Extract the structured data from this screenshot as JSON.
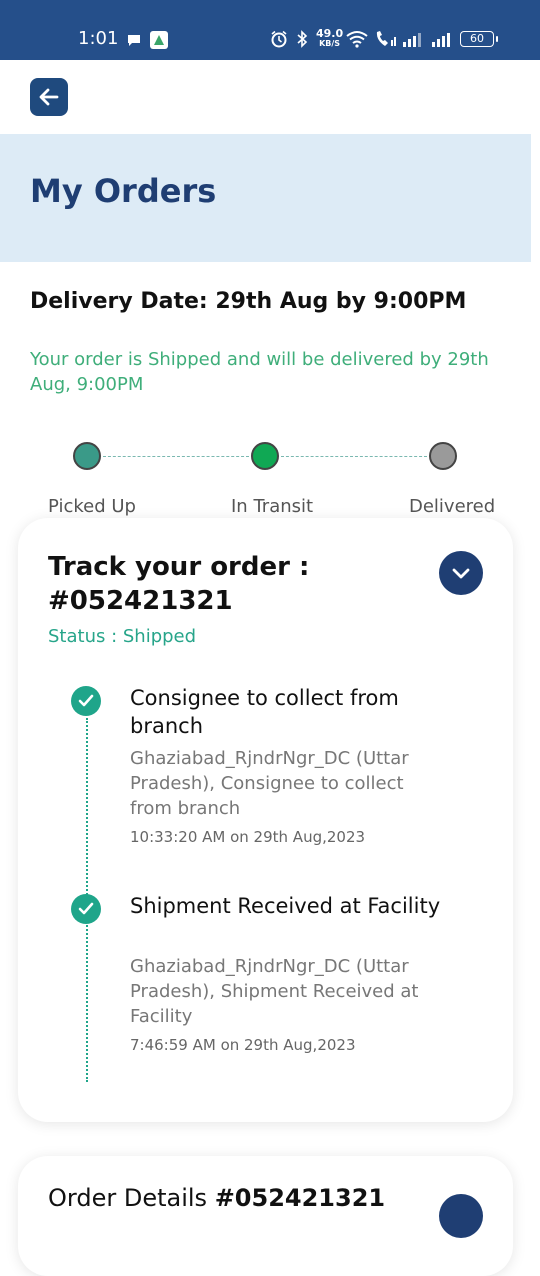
{
  "status_bar": {
    "time": "1:01",
    "network_speed_value": "49.0",
    "network_speed_unit": "KB/S",
    "battery": "60",
    "icons": [
      "chat-bubble-icon",
      "app-notification-icon",
      "alarm-icon",
      "bluetooth-icon",
      "wifi-icon",
      "wifi-call-icon",
      "signal-icon",
      "signal-icon",
      "battery-icon"
    ]
  },
  "app_bar": {
    "back_icon": "arrow-left-icon"
  },
  "header": {
    "title": "My Orders"
  },
  "delivery": {
    "date_text": "Delivery Date: 29th Aug by 9:00PM",
    "message": "Your order is Shipped and will be delivered by 29th Aug, 9:00PM"
  },
  "progress": {
    "steps": [
      {
        "label": "Picked Up",
        "color": "#3a9a88"
      },
      {
        "label": "In Transit",
        "color": "#10a854"
      },
      {
        "label": "Delivered",
        "color": "#9a9a9a"
      }
    ]
  },
  "tracking": {
    "title": "Track your order : #052421321",
    "status": "Status : Shipped",
    "toggle_icon": "chevron-down-icon",
    "events": [
      {
        "title": "Consignee to collect from branch",
        "description": "Ghaziabad_RjndrNgr_DC (Uttar Pradesh), Consignee to collect from branch",
        "time": "10:33:20 AM on 29th Aug,2023"
      },
      {
        "title": "Shipment Received at Facility",
        "description": "Ghaziabad_RjndrNgr_DC (Uttar Pradesh), Shipment Received at Facility",
        "time": "7:46:59 AM on 29th Aug,2023"
      }
    ]
  },
  "order_details": {
    "label": "Order Details",
    "order_number": "#052421321"
  },
  "colors": {
    "status_bar": "#254f8a",
    "primary": "#1f3e73",
    "header_band": "#ddebf6",
    "accent_green": "#1fa58a",
    "message_green": "#3fae7a"
  }
}
